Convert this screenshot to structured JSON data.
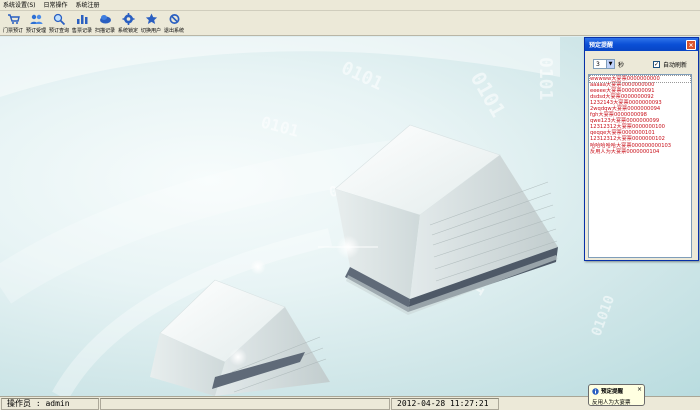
{
  "menu": [
    "系统设置(S)",
    "日常操作",
    "系统注册"
  ],
  "toolbar": [
    {
      "label": "门票预订",
      "icon": "cart-icon"
    },
    {
      "label": "预订受理",
      "icon": "users-icon"
    },
    {
      "label": "预订查询",
      "icon": "magnifier-icon"
    },
    {
      "label": "售票记录",
      "icon": "chart-icon"
    },
    {
      "label": "扫描记录",
      "icon": "cloud-icon"
    },
    {
      "label": "系统锁定",
      "icon": "gear-icon"
    },
    {
      "label": "切换用户",
      "icon": "star-icon"
    },
    {
      "label": "退出系统",
      "icon": "no-entry-icon"
    }
  ],
  "status": {
    "operator": "操作员 : admin",
    "datetime": "2012-04-28 11:27:21"
  },
  "reminder_window": {
    "title": "预定提醒",
    "interval_value": "3",
    "interval_unit": "秒",
    "auto_refresh_label": "自动刷新",
    "auto_refresh_checked": true,
    "items": [
      "wwwww大宴票0000000000",
      "aaaaa大宴票0000000000",
      "eeeee大宴票0000000091",
      "dsdsd大宴票0000000092",
      "1232143大宴票0000000093",
      "2wqdqw大宴票0000000094",
      "fgh大宴票0000000098",
      "qwe123大宴票0000000099",
      "12312312大宴票0000000100",
      "qeqqe大宴票0000000101",
      "12312312大宴票0000000102",
      "哈哈哈哈哈大宴票000000000103",
      "反用人为大宴票0000000104"
    ]
  },
  "tray_popup": {
    "title": "预定提醒",
    "message": "反用人为大宴票"
  },
  "colors": {
    "title_bar": "#0a4fd6",
    "list_text": "#c8101a",
    "chrome": "#ece9d8"
  }
}
